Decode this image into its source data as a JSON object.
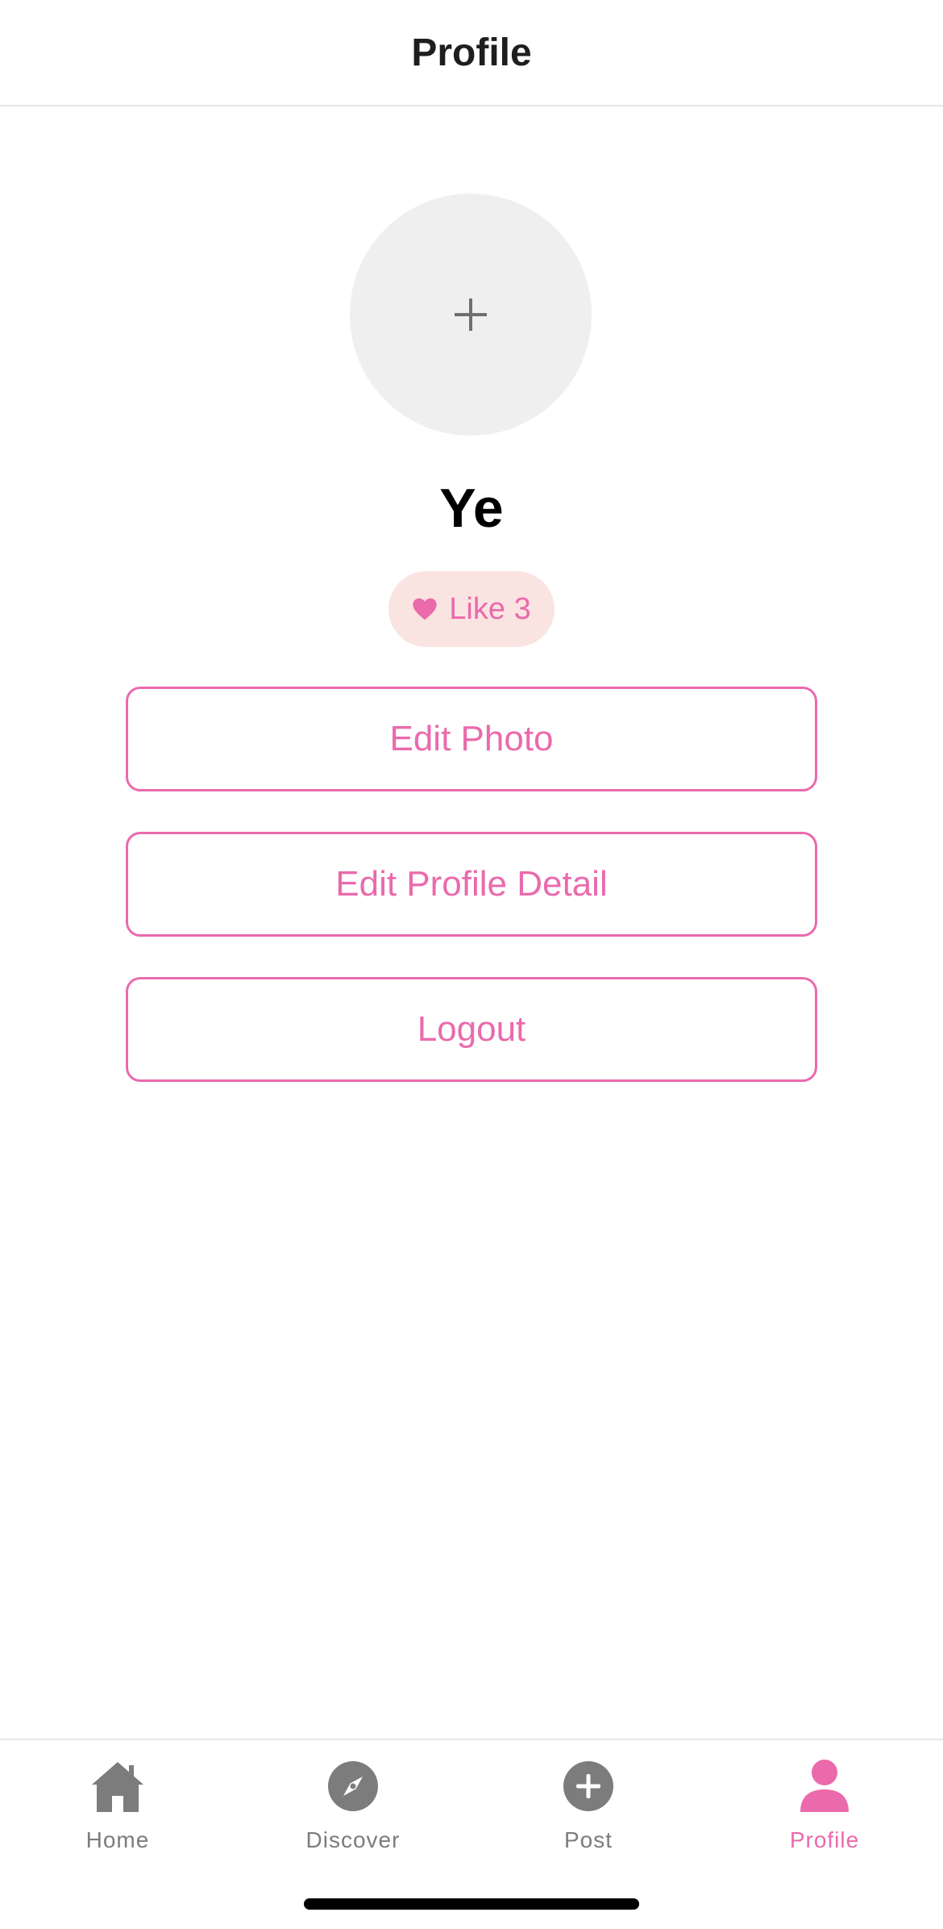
{
  "header": {
    "title": "Profile"
  },
  "profile": {
    "avatar_icon": "plus-icon",
    "name": "Ye",
    "like_label": "Like 3"
  },
  "actions": {
    "edit_photo": "Edit Photo",
    "edit_profile_detail": "Edit Profile Detail",
    "logout": "Logout"
  },
  "tabs": [
    {
      "label": "Home",
      "icon": "home-icon",
      "active": false
    },
    {
      "label": "Discover",
      "icon": "compass-icon",
      "active": false
    },
    {
      "label": "Post",
      "icon": "add-circle-icon",
      "active": false
    },
    {
      "label": "Profile",
      "icon": "person-icon",
      "active": true
    }
  ],
  "colors": {
    "accent": "#ea6aac",
    "badge_bg": "#fae4e2",
    "inactive_icon": "#7c7c7c",
    "avatar_bg": "#efefef"
  }
}
